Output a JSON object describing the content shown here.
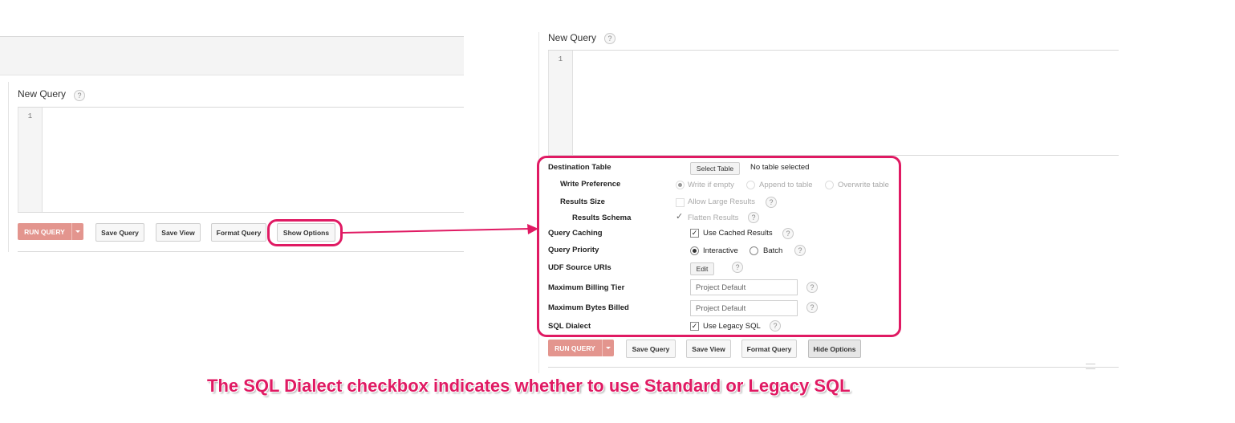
{
  "left_panel": {
    "query_title": "New Query",
    "help_glyph": "?",
    "line_number": "1",
    "buttons": {
      "run_query": "RUN QUERY",
      "save_query": "Save Query",
      "save_view": "Save View",
      "format_query": "Format Query",
      "show_options": "Show Options"
    }
  },
  "right_panel": {
    "query_title": "New Query",
    "help_glyph": "?",
    "line_number": "1",
    "options": {
      "destination_table": {
        "label": "Destination Table",
        "button": "Select Table",
        "value": "No table selected"
      },
      "write_preference": {
        "label": "Write Preference",
        "choices": [
          "Write if empty",
          "Append to table",
          "Overwrite table"
        ],
        "selected": "Write if empty",
        "disabled": true
      },
      "results_size": {
        "label": "Results Size",
        "checkbox_label": "Allow Large Results",
        "checked": false,
        "disabled": true
      },
      "results_schema": {
        "label": "Results Schema",
        "checkbox_label": "Flatten Results",
        "checked": true,
        "disabled": true
      },
      "query_caching": {
        "label": "Query Caching",
        "checkbox_label": "Use Cached Results",
        "checked": true
      },
      "query_priority": {
        "label": "Query Priority",
        "choices": [
          "Interactive",
          "Batch"
        ],
        "selected": "Interactive"
      },
      "udf_source_uris": {
        "label": "UDF Source URIs",
        "button": "Edit"
      },
      "max_billing_tier": {
        "label": "Maximum Billing Tier",
        "placeholder": "Project Default"
      },
      "max_bytes_billed": {
        "label": "Maximum Bytes Billed",
        "placeholder": "Project Default"
      },
      "sql_dialect": {
        "label": "SQL Dialect",
        "checkbox_label": "Use Legacy SQL",
        "checked": true
      }
    },
    "buttons": {
      "run_query": "RUN QUERY",
      "save_query": "Save Query",
      "save_view": "Save View",
      "format_query": "Format Query",
      "hide_options": "Hide Options"
    }
  },
  "annotation": {
    "caption": "The SQL Dialect checkbox indicates whether to use Standard or Legacy SQL",
    "accent_color": "#e01a63"
  }
}
